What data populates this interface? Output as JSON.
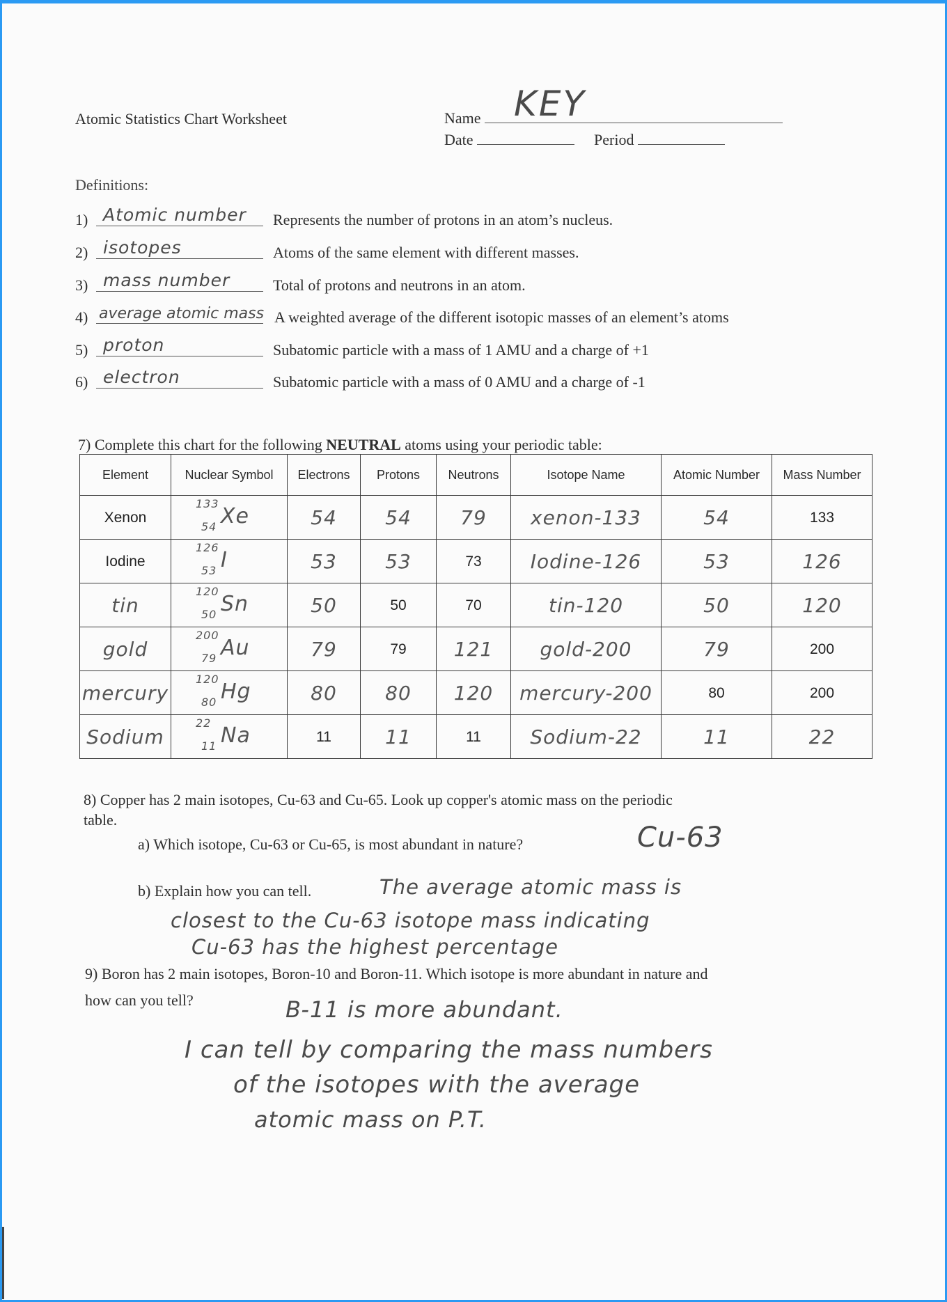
{
  "header": {
    "title": "Atomic Statistics Chart Worksheet",
    "name_label": "Name",
    "name_value": "KEY",
    "date_label": "Date",
    "date_value": "",
    "period_label": "Period",
    "period_value": ""
  },
  "definitions": {
    "heading": "Definitions:",
    "items": [
      {
        "num": "1)",
        "answer": "Atomic number",
        "text": "Represents the number of protons in an atom’s nucleus."
      },
      {
        "num": "2)",
        "answer": "isotopes",
        "text": "Atoms of the same element with different masses."
      },
      {
        "num": "3)",
        "answer": "mass number",
        "text": "Total of protons and neutrons in an atom."
      },
      {
        "num": "4)",
        "answer": "average atomic mass",
        "text": "A weighted average of the different isotopic masses of an element’s atoms"
      },
      {
        "num": "5)",
        "answer": "proton",
        "text": "Subatomic particle with a mass of 1 AMU and a charge of +1"
      },
      {
        "num": "6)",
        "answer": "electron",
        "text": "Subatomic particle with a mass of 0 AMU and a charge of -1"
      }
    ]
  },
  "q7": {
    "prompt_before": "7) Complete this chart for the following ",
    "prompt_bold": "NEUTRAL",
    "prompt_after": " atoms using your periodic table:",
    "columns": [
      "Element",
      "Nuclear Symbol",
      "Electrons",
      "Protons",
      "Neutrons",
      "Isotope Name",
      "Atomic Number",
      "Mass Number"
    ],
    "rows": [
      {
        "element": "Xenon",
        "mass": "133",
        "z": "54",
        "symbol": "Xe",
        "electrons": "54",
        "protons": "54",
        "neutrons": "79",
        "isotope": "xenon-133",
        "atomic_number": "54",
        "mass_number": "133"
      },
      {
        "element": "Iodine",
        "mass": "126",
        "z": "53",
        "symbol": "I",
        "electrons": "53",
        "protons": "53",
        "neutrons": "73",
        "isotope": "Iodine-126",
        "atomic_number": "53",
        "mass_number": "126"
      },
      {
        "element": "tin",
        "mass": "120",
        "z": "50",
        "symbol": "Sn",
        "electrons": "50",
        "protons": "50",
        "neutrons": "70",
        "isotope": "tin-120",
        "atomic_number": "50",
        "mass_number": "120"
      },
      {
        "element": "gold",
        "mass": "200",
        "z": "79",
        "symbol": "Au",
        "electrons": "79",
        "protons": "79",
        "neutrons": "121",
        "isotope": "gold-200",
        "atomic_number": "79",
        "mass_number": "200"
      },
      {
        "element": "mercury",
        "mass": "120",
        "z": "80",
        "symbol": "Hg",
        "electrons": "80",
        "protons": "80",
        "neutrons": "120",
        "isotope": "mercury-200",
        "atomic_number": "80",
        "mass_number": "200"
      },
      {
        "element": "Sodium",
        "mass": "22",
        "z": "11",
        "symbol": "Na",
        "electrons": "11",
        "protons": "11",
        "neutrons": "11",
        "isotope": "Sodium-22",
        "atomic_number": "11",
        "mass_number": "22"
      }
    ],
    "printed_cells": {
      "0": [
        "element",
        "mass_number"
      ],
      "1": [
        "element",
        "neutrons"
      ],
      "2": [
        "protons",
        "neutrons"
      ],
      "3": [
        "protons",
        "mass_number"
      ],
      "4": [
        "atomic_number",
        "mass_number"
      ],
      "5": [
        "electrons",
        "neutrons"
      ]
    }
  },
  "q8": {
    "prompt_line1": "8)  Copper has 2 main isotopes, Cu-63 and Cu-65.   Look up copper's atomic mass on the periodic",
    "prompt_line2": "table.",
    "a_prompt": "a) Which isotope, Cu-63 or Cu-65, is most abundant in nature?",
    "a_answer": "Cu-63",
    "b_prompt": "b) Explain how you can tell.",
    "b_answer_lines": [
      "The average atomic mass is",
      "closest to the Cu-63 isotope mass indicating",
      "Cu-63 has the highest percentage"
    ]
  },
  "q9": {
    "prompt_line1": "9) Boron has 2 main isotopes, Boron-10 and Boron-11.  Which isotope is more abundant in nature and",
    "prompt_line2": "how can you tell?",
    "answer_lines": [
      "B-11 is more abundant.",
      "I can tell by comparing the mass numbers",
      "of the isotopes with the average",
      "atomic mass on P.T."
    ]
  }
}
